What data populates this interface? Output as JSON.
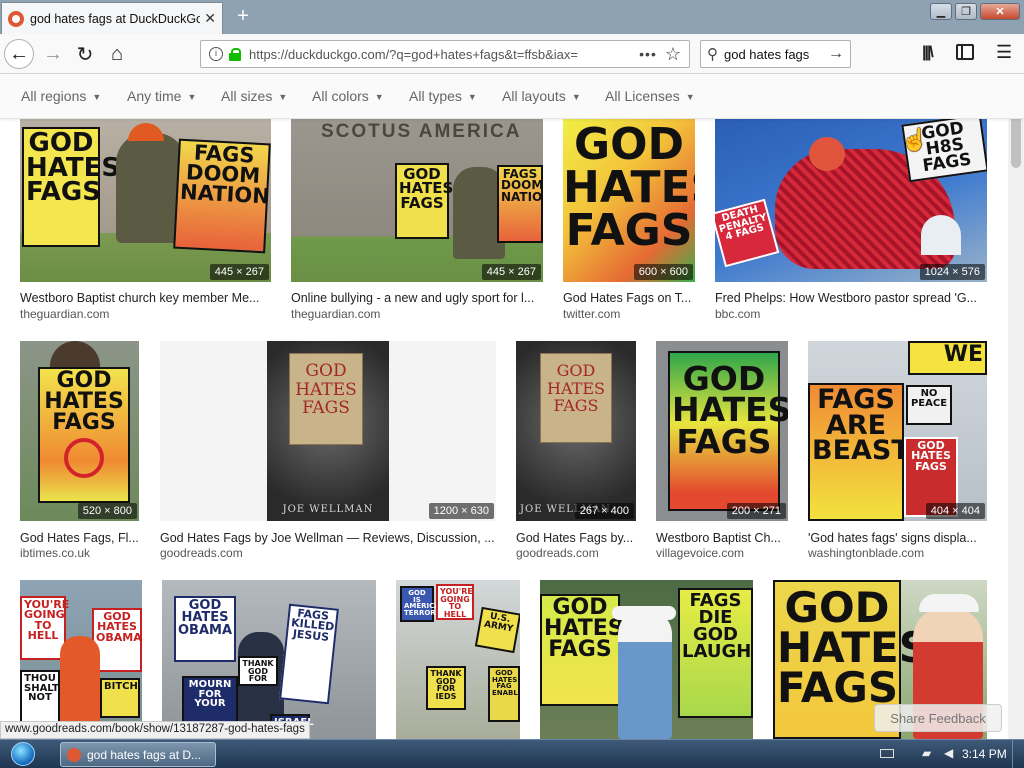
{
  "browser": {
    "tab_title": "god hates fags at DuckDuckGo",
    "url": "https://duckduckgo.com/?q=god+hates+fags&t=ffsb&iax=",
    "search_text": "god hates fags"
  },
  "filters": [
    {
      "label": "All regions"
    },
    {
      "label": "Any time"
    },
    {
      "label": "All sizes"
    },
    {
      "label": "All colors"
    },
    {
      "label": "All types"
    },
    {
      "label": "All layouts"
    },
    {
      "label": "All Licenses"
    }
  ],
  "results": [
    {
      "title": "Westboro Baptist church key member Me...",
      "source": "theguardian.com",
      "dims": "445 × 267",
      "signs": [
        "GOD HATES FAGS",
        "FAGS DOOM NATIONS"
      ]
    },
    {
      "title": "Online bullying - a new and ugly sport for l...",
      "source": "theguardian.com",
      "dims": "445 × 267",
      "signs": [
        "GOD HATES FAGS",
        "FAGS DOOM NATIONS"
      ],
      "caption": "SCOTUS AMERICA"
    },
    {
      "title": "God Hates Fags on T...",
      "source": "twitter.com",
      "dims": "600 × 600",
      "signs": [
        "GOD HATES FAGS"
      ]
    },
    {
      "title": "Fred Phelps: How Westboro pastor spread 'G...",
      "source": "bbc.com",
      "dims": "1024 × 576",
      "signs": [
        "GOD H8S FAGS",
        "DEATH PENALTY 4 FAGS"
      ]
    },
    {
      "title": "God Hates Fags, Fl...",
      "source": "ibtimes.co.uk",
      "dims": "520 × 800",
      "signs": [
        "GOD HATES FAGS"
      ]
    },
    {
      "title": "God Hates Fags by Joe Wellman — Reviews, Discussion, ...",
      "source": "goodreads.com",
      "dims": "1200 × 630",
      "signs": [
        "GOD HATES FAGS"
      ],
      "author": "JOE WELLMAN"
    },
    {
      "title": "God Hates Fags by...",
      "source": "goodreads.com",
      "dims": "267 × 400",
      "signs": [
        "GOD HATES FAGS"
      ],
      "author": "JOE WELLMAN"
    },
    {
      "title": "Westboro Baptist Ch...",
      "source": "villagevoice.com",
      "dims": "200 × 271",
      "signs": [
        "GOD HATES FAGS"
      ]
    },
    {
      "title": "'God hates fags' signs displa...",
      "source": "washingtonblade.com",
      "dims": "404 × 404",
      "signs": [
        "FAGS ARE BEASTS",
        "NO PEACE",
        "GOD HATES FAGS",
        "WE"
      ]
    },
    {
      "signs": [
        "YOU'RE GOING TO HELL",
        "GOD HATES OBAMA",
        "BITCH",
        "THOU SHALT NOT"
      ]
    },
    {
      "signs": [
        "GOD HATES OBAMA",
        "THANK GOD FOR",
        "FAGS KILLED JESUS",
        "ISRAEL",
        "MOURN FOR YOUR"
      ]
    },
    {
      "signs": [
        "GOD IS AMERICA'S TERROR",
        "YOU'RE GOING TO HELL",
        "U.S. ARMY",
        "THANK GOD FOR IEDS",
        "GOD HATES FAG ENABLERS"
      ]
    },
    {
      "signs": [
        "GOD HATES FAGS",
        "FAGS DIE GOD LAUGHS"
      ]
    },
    {
      "signs": [
        "GOD HATES FAGS"
      ]
    }
  ],
  "status_url": "www.goodreads.com/book/show/13187287-god-hates-fags",
  "feedback_label": "Share Feedback",
  "taskbar": {
    "item_label": "god hates fags at D...",
    "clock": "3:14 PM"
  }
}
